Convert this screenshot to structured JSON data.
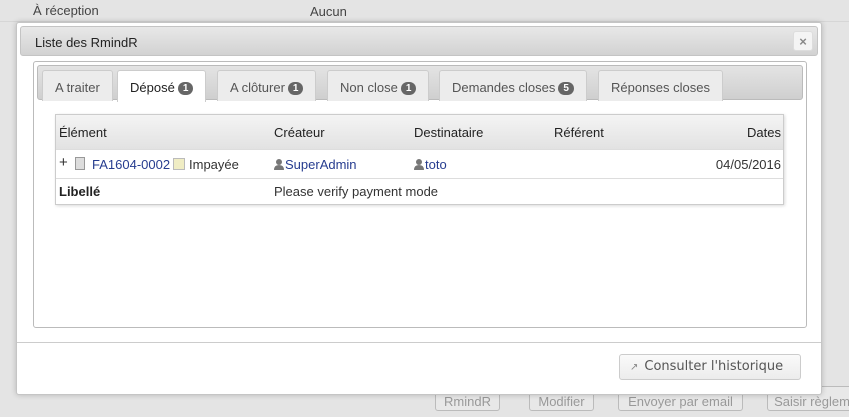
{
  "background": {
    "field_label": "À réception",
    "field_value": "Aucun",
    "buttons": [
      "RmindR",
      "Modifier",
      "Envoyer par email",
      "Saisir règlem"
    ]
  },
  "dialog": {
    "title": "Liste des RmindR",
    "close_label": "×",
    "tabs": [
      {
        "label": "A traiter",
        "badge": null
      },
      {
        "label": "Déposé",
        "badge": "1",
        "active": true
      },
      {
        "label": "A clôturer",
        "badge": "1"
      },
      {
        "label": "Non close",
        "badge": "1"
      },
      {
        "label": "Demandes closes",
        "badge": "5"
      },
      {
        "label": "Réponses closes",
        "badge": null
      }
    ],
    "table": {
      "headers": [
        "Élément",
        "Créateur",
        "Destinataire",
        "Référent",
        "Dates"
      ],
      "rows": [
        {
          "expand": "+",
          "ref": "FA1604-0002",
          "status": "Impayée",
          "creator": "SuperAdmin",
          "recipient": "toto",
          "referent": "",
          "date": "04/05/2016",
          "label_title": "Libellé",
          "label": "Please verify payment mode"
        }
      ]
    },
    "history_button": "Consulter l'historique"
  }
}
